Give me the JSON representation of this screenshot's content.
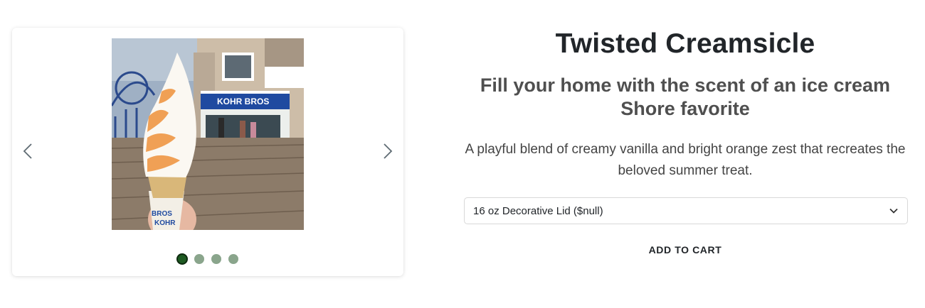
{
  "product": {
    "title": "Twisted Creamsicle",
    "subtitle": "Fill your home with the scent of an ice cream Shore favorite",
    "description": "A playful blend of creamy vanilla and bright orange zest that recreates the beloved summer treat.",
    "selected_variant": "16 oz Decorative Lid ($null)",
    "add_to_cart_label": "ADD TO CART"
  },
  "carousel": {
    "image_description": "Soft-serve orange and vanilla twist cone held in front of Kohr Bros stand on a boardwalk",
    "sign_text": "KOHR BROS",
    "slide_count": 4,
    "active_index": 0,
    "prev_icon": "chevron-left-icon",
    "next_icon": "chevron-right-icon"
  },
  "colors": {
    "dot_active": "#1e5a22",
    "dot_inactive": "#8aa58c",
    "title": "#212529",
    "subtitle": "#4f4f4f"
  }
}
